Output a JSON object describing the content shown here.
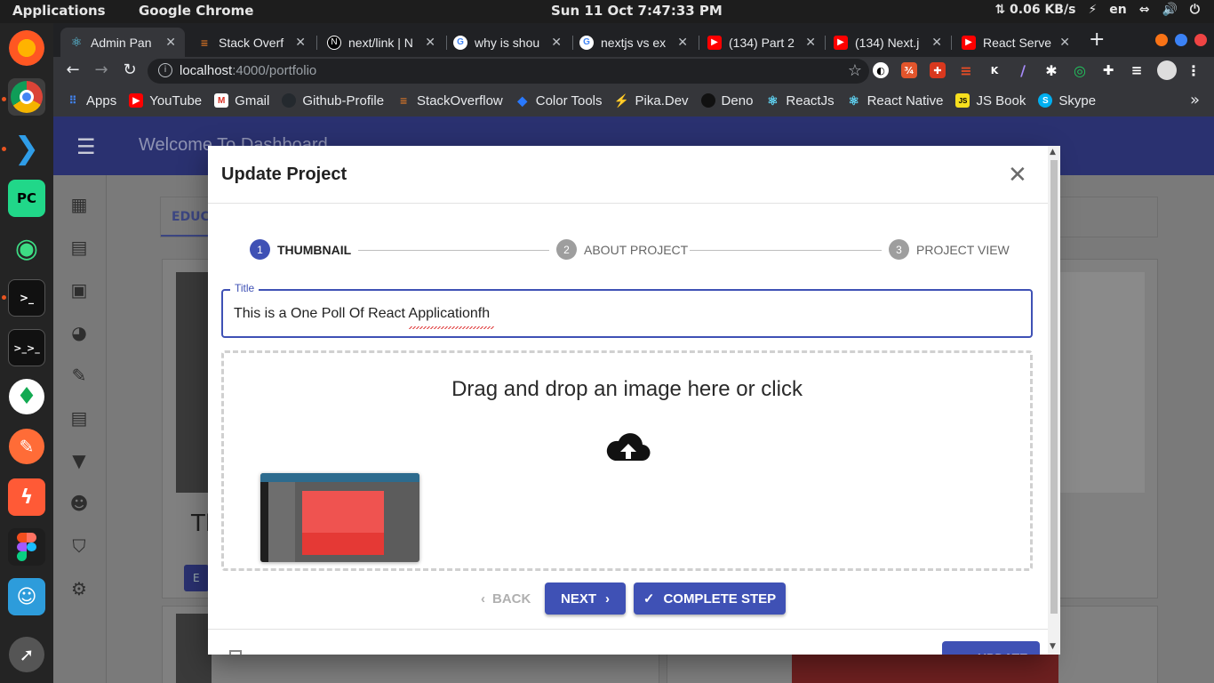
{
  "os_bar": {
    "applications": "Applications",
    "app": "Google Chrome",
    "clock": "Sun 11 Oct   7:47:33 PM",
    "network": "⇅ 0.06 KB/s",
    "lang": "en"
  },
  "tabs": [
    {
      "title": "Admin Pan",
      "color": "#4285f4",
      "glyph": "⚛"
    },
    {
      "title": "Stack Overf",
      "color": "#f48024",
      "glyph": "S"
    },
    {
      "title": "next/link | N",
      "color": "#000000",
      "glyph": "N"
    },
    {
      "title": "why is shou",
      "color": "#ffffff",
      "glyph": "G"
    },
    {
      "title": "nextjs vs ex",
      "color": "#ffffff",
      "glyph": "G"
    },
    {
      "title": "(134) Part 2",
      "color": "#ff0000",
      "glyph": "▶"
    },
    {
      "title": "(134) Next.j",
      "color": "#ff0000",
      "glyph": "▶"
    },
    {
      "title": "React Serve",
      "color": "#ff0000",
      "glyph": "▶"
    }
  ],
  "omnibox": {
    "host": "localhost",
    "path": ":4000/portfolio"
  },
  "bookmarks": [
    {
      "label": "Apps",
      "color": "#ea4335",
      "glyph": "⋮⋮"
    },
    {
      "label": "YouTube",
      "color": "#ff0000",
      "glyph": "▶"
    },
    {
      "label": "Gmail",
      "color": "#d93025",
      "glyph": "M"
    },
    {
      "label": "Github-Profile",
      "color": "#24292e",
      "glyph": "●"
    },
    {
      "label": "StackOverflow",
      "color": "#f48024",
      "glyph": "S"
    },
    {
      "label": "Color Tools",
      "color": "#2979ff",
      "glyph": "◆"
    },
    {
      "label": "Pika.Dev",
      "color": "#f9a825",
      "glyph": "⚡"
    },
    {
      "label": "Deno",
      "color": "#111111",
      "glyph": "●"
    },
    {
      "label": "ReactJs",
      "color": "#35363a",
      "glyph": "⚛"
    },
    {
      "label": "React Native",
      "color": "#35363a",
      "glyph": "⚛"
    },
    {
      "label": "JS Book",
      "color": "#f7df1e",
      "glyph": "JS"
    },
    {
      "label": "Skype",
      "color": "#00aff0",
      "glyph": "S"
    }
  ],
  "app": {
    "welcome": "Welcome To Dashboard",
    "bg_tab": "EDUCA",
    "bg_card_title": "Th",
    "bg_card_btn": "E"
  },
  "dialog": {
    "title": "Update Project",
    "steps": [
      {
        "num": "1",
        "label": "THUMBNAIL",
        "state": "active"
      },
      {
        "num": "2",
        "label": "ABOUT PROJECT",
        "state": "inactive"
      },
      {
        "num": "3",
        "label": "PROJECT VIEW",
        "state": "inactive"
      }
    ],
    "title_field": {
      "label": "Title",
      "value": "This is a One Poll Of React Applicationfh"
    },
    "dropzone_text": "Drag and drop an image here or click",
    "back_label": "BACK",
    "next_label": "NEXT",
    "complete_label": "COMPLETE STEP",
    "update_label": "UPDATE"
  },
  "colors": {
    "primary": "#3f51b5",
    "appbar": "#2a3170"
  }
}
